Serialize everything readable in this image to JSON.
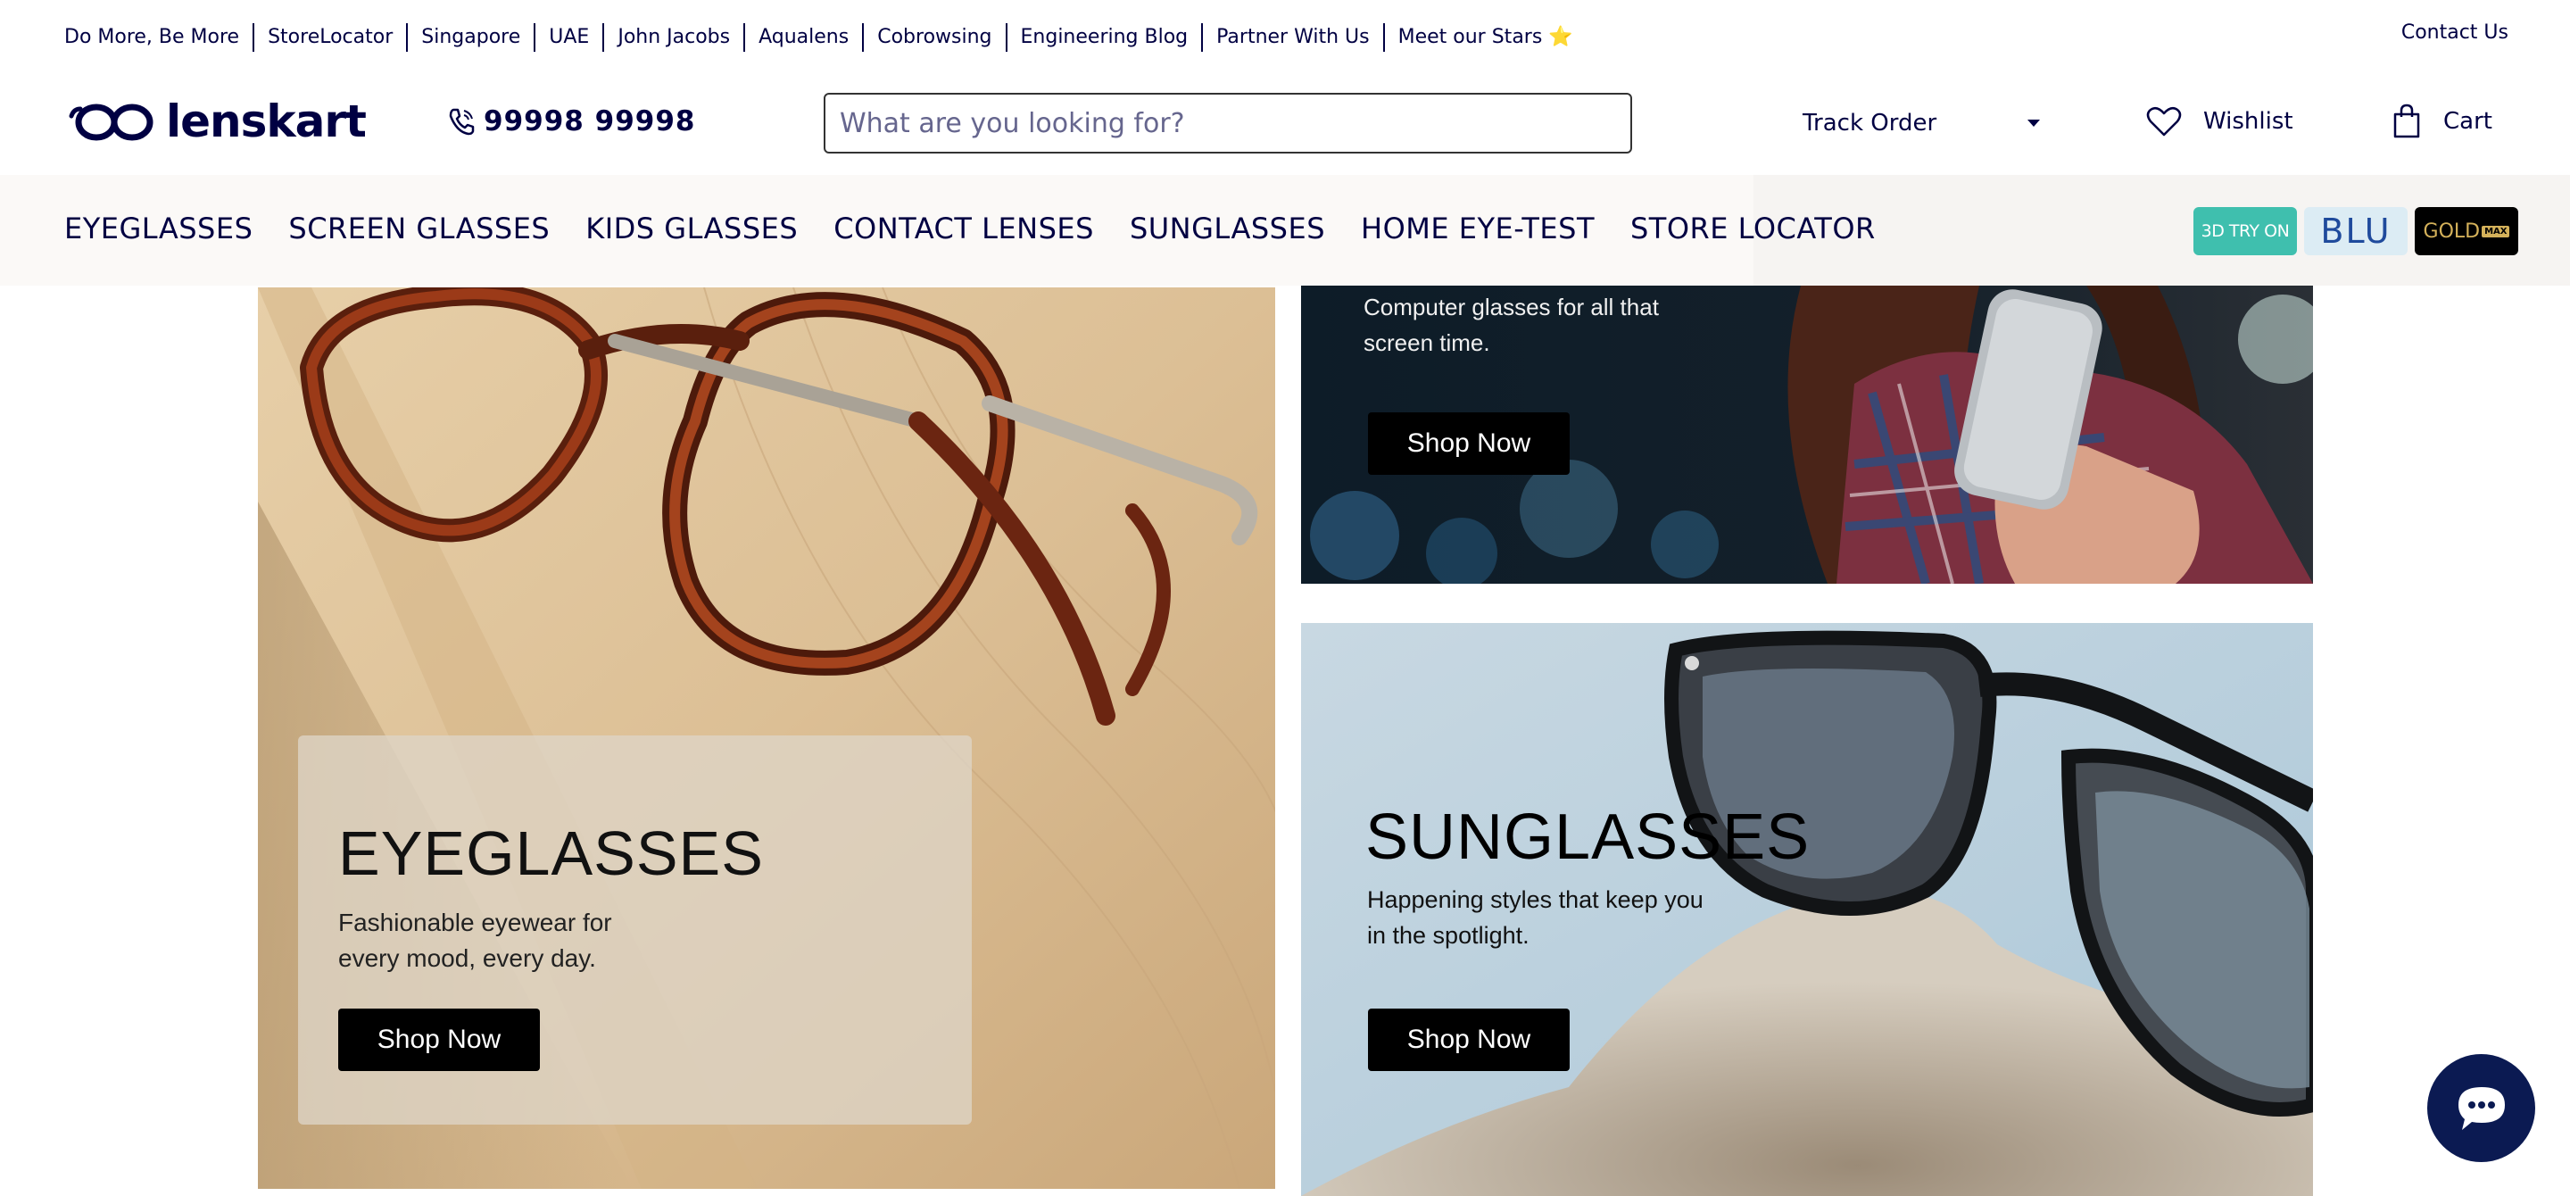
{
  "top_links": [
    "Do More, Be More",
    "StoreLocator",
    "Singapore",
    "UAE",
    "John Jacobs",
    "Aqualens",
    "Cobrowsing",
    "Engineering Blog",
    "Partner With Us",
    "Meet our Stars ⭐"
  ],
  "contact_label": "Contact Us",
  "header": {
    "logo_text": "lenskart",
    "phone": "99998 99998",
    "search_placeholder": "What are you looking for?",
    "track_order": "Track Order",
    "wishlist": "Wishlist",
    "cart": "Cart"
  },
  "nav": {
    "categories": [
      "EYEGLASSES",
      "SCREEN GLASSES",
      "KIDS GLASSES",
      "CONTACT LENSES",
      "SUNGLASSES",
      "HOME EYE-TEST",
      "STORE LOCATOR"
    ],
    "badges": {
      "try_on": "3D TRY ON",
      "blu": "BLU",
      "gold": "GOLD",
      "gold_max": "MAX"
    }
  },
  "banners": {
    "eyeglasses": {
      "title": "EYEGLASSES",
      "subtitle": "Fashionable eyewear for every mood, every day.",
      "cta": "Shop Now"
    },
    "computer": {
      "subtitle": "Computer glasses for all that screen time.",
      "cta": "Shop Now"
    },
    "sunglasses": {
      "title": "SUNGLASSES",
      "subtitle": "Happening styles that keep you in the spotlight.",
      "cta": "Shop Now"
    }
  },
  "colors": {
    "brand_navy": "#000042",
    "nav_bg": "#fbf9f7",
    "try_on_teal": "#3fbfae",
    "chat_bg": "#0b1a52"
  },
  "icons": {
    "logo": "lenskart-glasses-logo",
    "phone": "phone-icon",
    "wishlist": "heart-icon",
    "cart": "shopping-bag-icon",
    "chat": "chat-bubble-icon"
  }
}
